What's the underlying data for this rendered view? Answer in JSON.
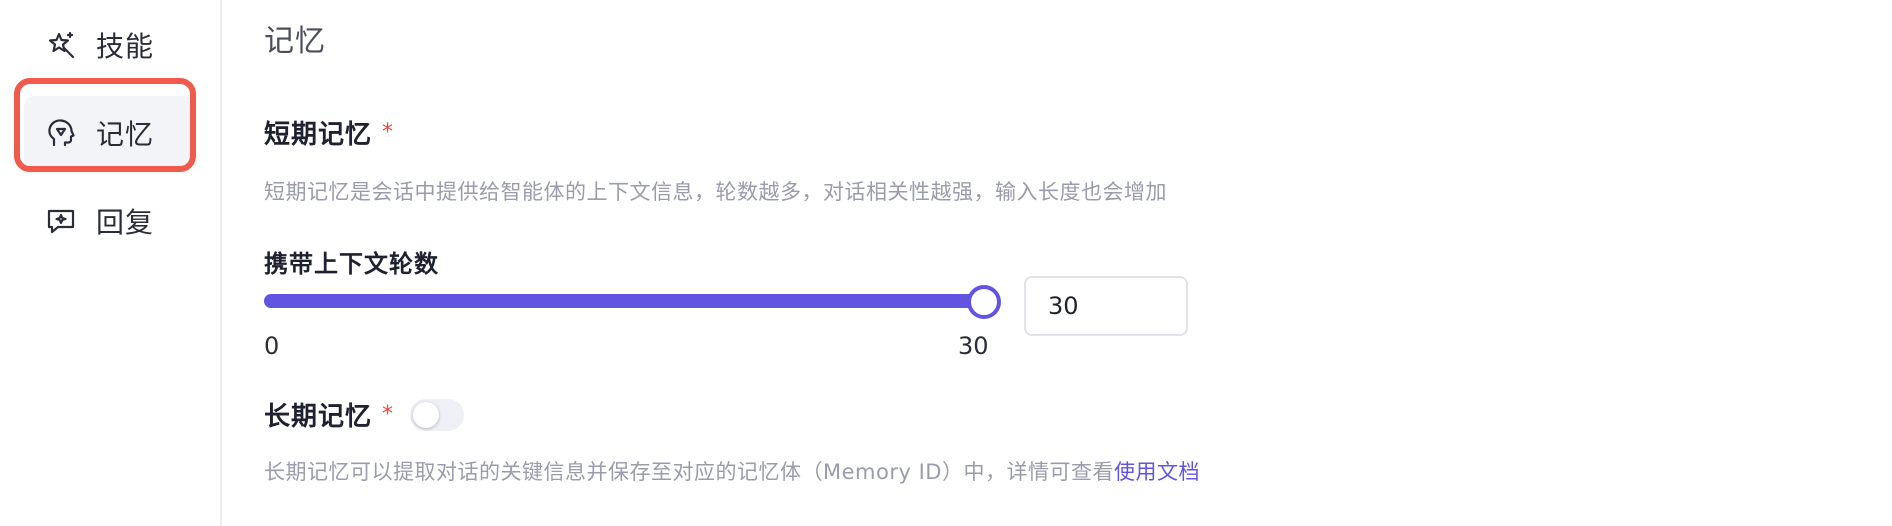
{
  "sidebar": {
    "items": [
      {
        "label": "技能",
        "icon": "sparkle-wand-icon"
      },
      {
        "label": "记忆",
        "icon": "head-brain-icon",
        "active": true
      },
      {
        "label": "回复",
        "icon": "chat-sparkle-icon"
      }
    ],
    "highlight_color": "#f05a4a"
  },
  "main": {
    "title": "记忆",
    "short_memory": {
      "title": "短期记忆",
      "required_mark": "*",
      "description": "短期记忆是会话中提供给智能体的上下文信息，轮数越多，对话相关性越强，输入长度也会增加",
      "rounds_label": "携带上下文轮数",
      "slider": {
        "min": "0",
        "max": "30",
        "value": 30,
        "fill_fraction": 1.0
      },
      "input_value": "30"
    },
    "long_memory": {
      "title": "长期记忆",
      "required_mark": "*",
      "toggle_on": false,
      "description": "长期记忆可以提取对话的关键信息并保存至对应的记忆体（Memory ID）中，详情可查看",
      "doc_link": "使用文档"
    }
  },
  "colors": {
    "accent": "#6254e3",
    "required": "#f0473d",
    "muted_text": "#9a9cab"
  }
}
